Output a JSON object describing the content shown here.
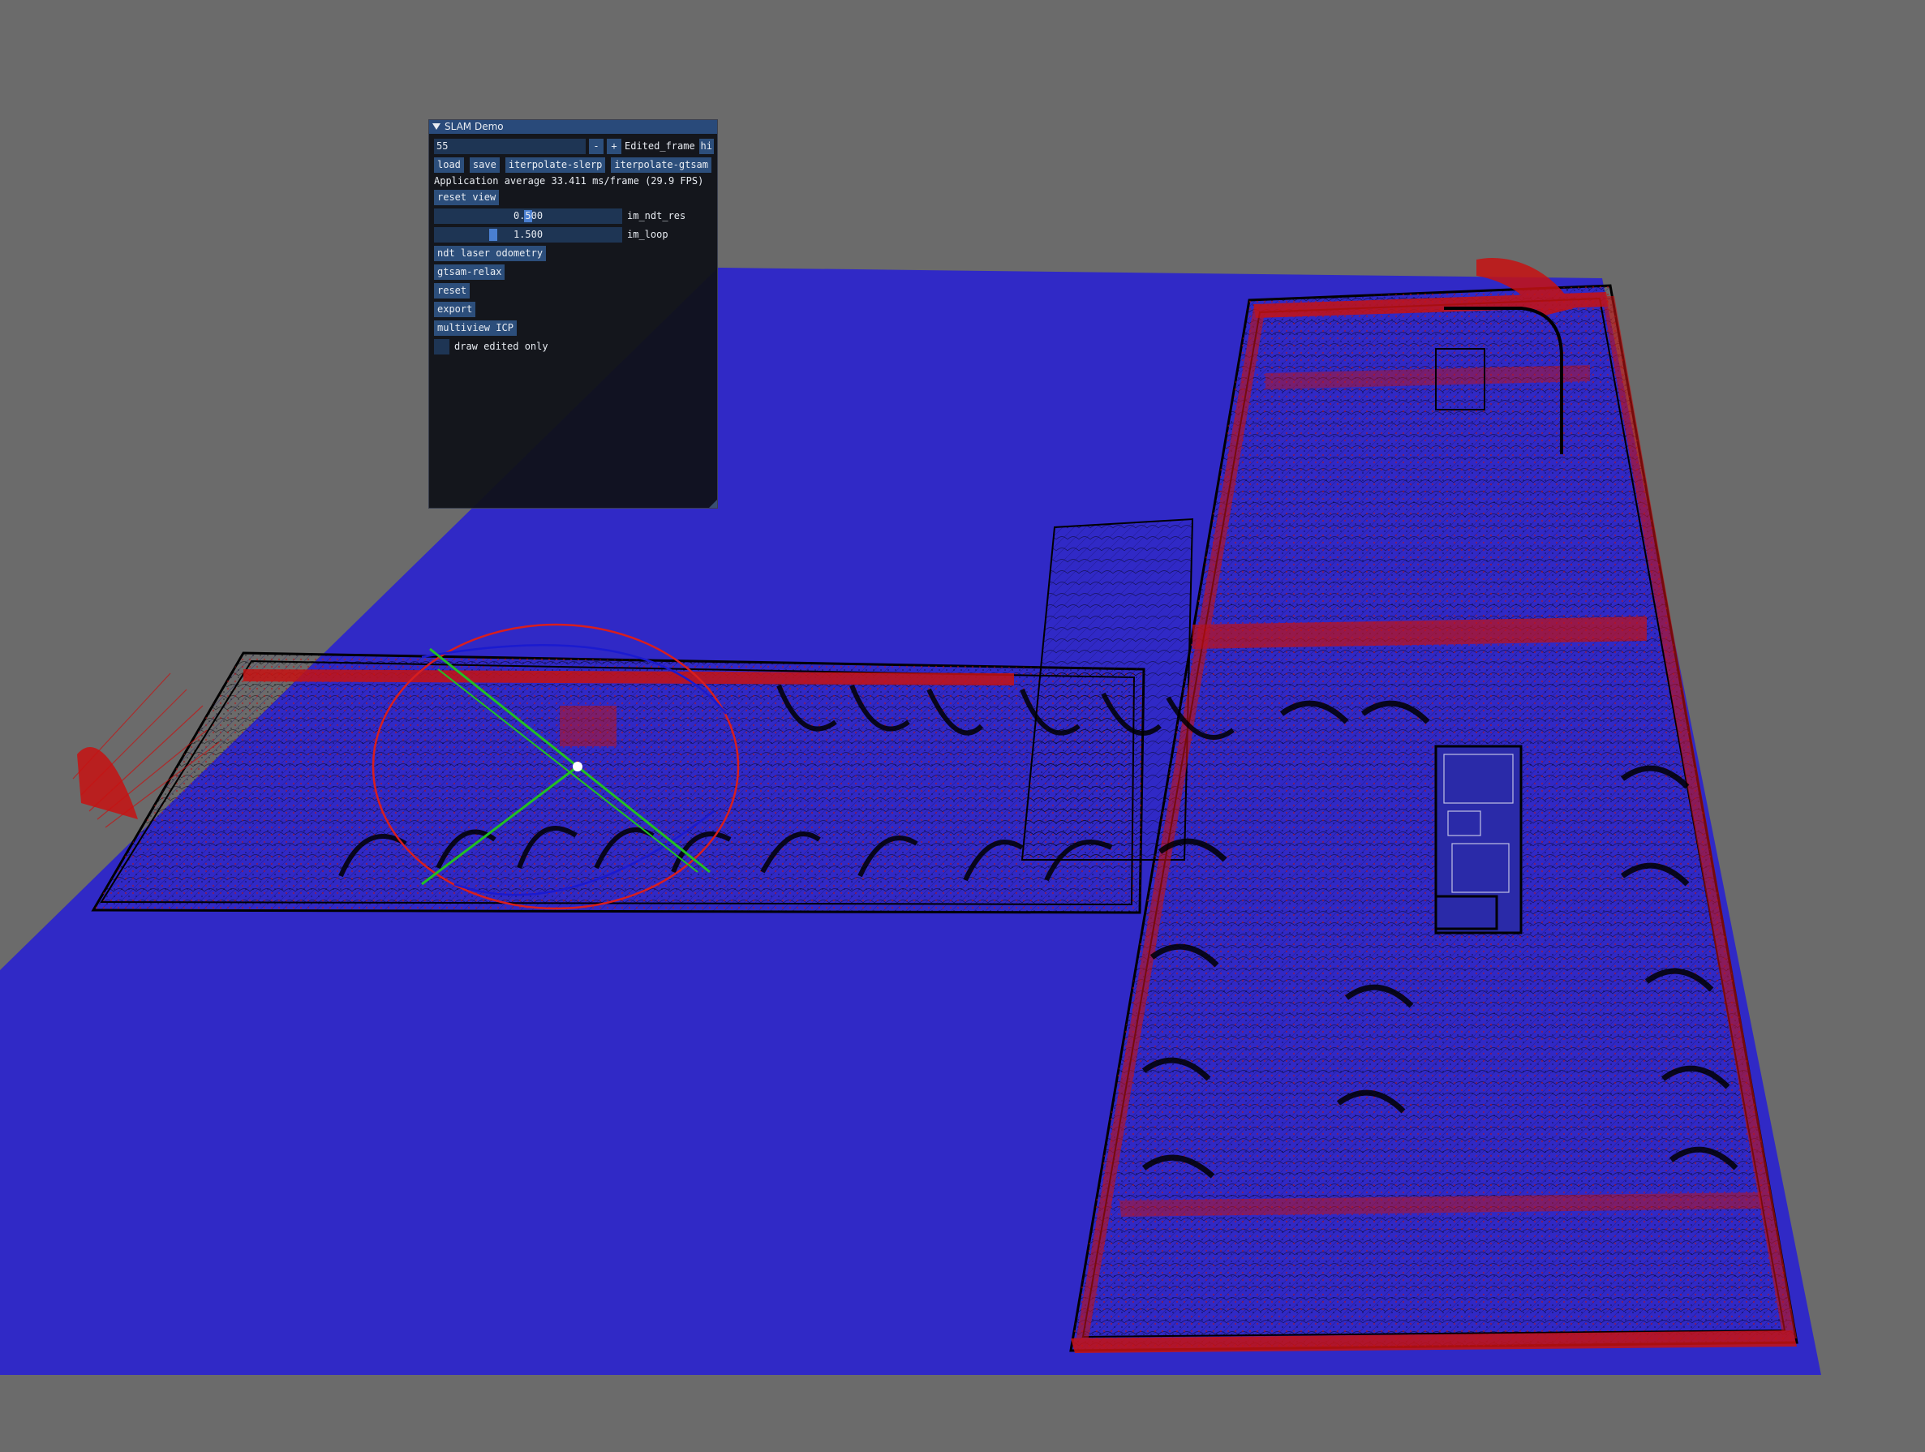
{
  "window": {
    "title": "SLAM Demo"
  },
  "frame": {
    "value": "55",
    "minus_label": "-",
    "plus_label": "+",
    "name": "Edited_frame",
    "hide_label": "hi"
  },
  "toolbar": {
    "load_label": "load",
    "save_label": "save",
    "slerp_label": "iterpolate-slerp",
    "gtsam_label": "iterpolate-gtsam"
  },
  "stats": {
    "text": "Application average 33.411 ms/frame (29.9 FPS)"
  },
  "buttons": {
    "reset_view": "reset view",
    "ndt": "ndt laser odometry",
    "gtsam_relax": "gtsam-relax",
    "reset": "reset",
    "export": "export",
    "multiview_icp": "multiview ICP"
  },
  "sliders": {
    "ndt_res": {
      "value": "0.500",
      "label": "im_ndt_res",
      "level": 0.5
    },
    "loop": {
      "value": "1.500",
      "label": "im_loop",
      "level": 0.3
    }
  },
  "checkbox": {
    "draw_edited_only": {
      "label": "draw edited only",
      "checked": false
    }
  },
  "colors": {
    "background": "#6b6b6b",
    "ground_plane": "#3029c6",
    "points": "#cc1010",
    "walls": "#000000",
    "panel_bg": "#0f1117",
    "panel_title": "#294a7a",
    "button": "#2c4e7b",
    "gizmo_red": "#d81e1e",
    "gizmo_green": "#22c022",
    "gizmo_blue": "#1a1ad0"
  }
}
